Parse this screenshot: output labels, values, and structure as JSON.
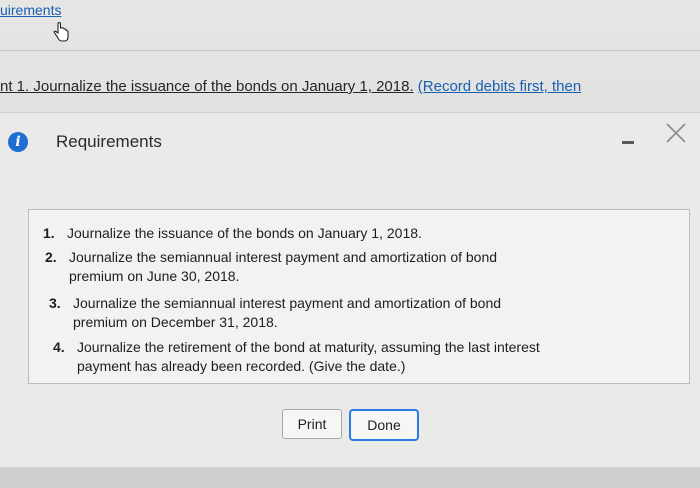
{
  "header": {
    "link_text": "uirements",
    "instruction_main": "nt 1. Journalize the issuance of the bonds on January 1, 2018.",
    "instruction_note": "(Record debits first, then"
  },
  "dialog": {
    "title": "Requirements",
    "info_icon_glyph": "i",
    "items": [
      {
        "number": "1.",
        "line1": "Journalize the issuance of the bonds on January 1, 2018.",
        "line2": ""
      },
      {
        "number": "2.",
        "line1": "Journalize the semiannual interest payment and amortization of bond",
        "line2": "premium on June 30, 2018."
      },
      {
        "number": "3.",
        "line1": "Journalize the semiannual interest payment and amortization of bond",
        "line2": "premium on December 31, 2018."
      },
      {
        "number": "4.",
        "line1": "Journalize the retirement of the bond at maturity, assuming the last interest",
        "line2": "payment has already been recorded. (Give the date.)"
      }
    ],
    "print_label": "Print",
    "done_label": "Done"
  },
  "colors": {
    "link": "#1a5fb4",
    "info_icon": "#1f6fd1",
    "done_border": "#2c7be5"
  },
  "icons": {
    "cursor": "hand-pointer-icon",
    "info": "info-icon",
    "minimize": "minimize-icon",
    "close": "close-icon"
  }
}
